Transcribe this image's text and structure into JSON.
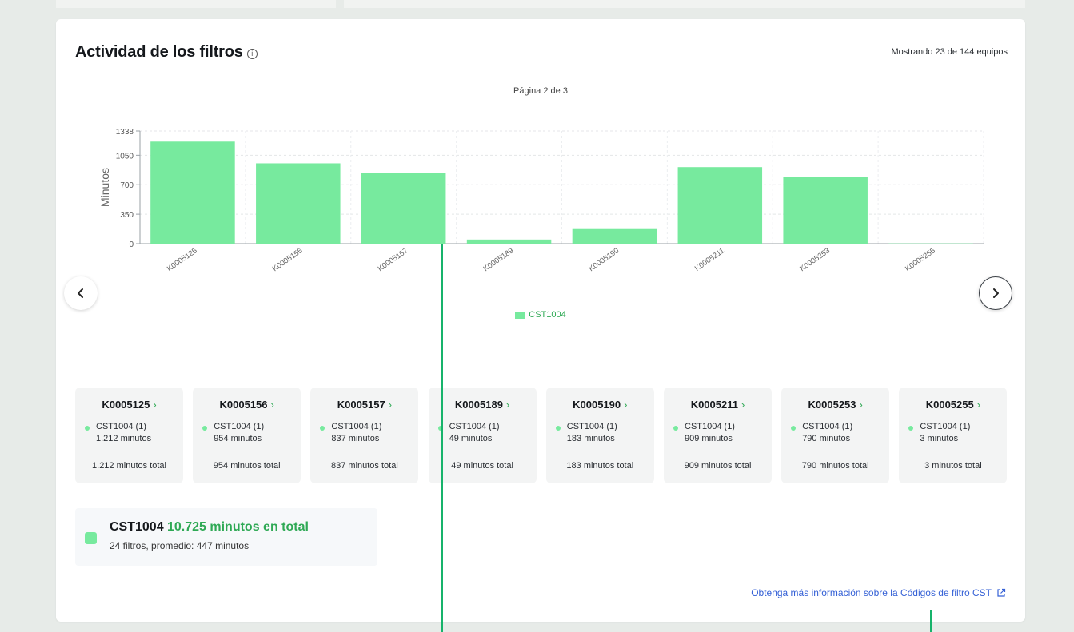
{
  "title": "Actividad de los filtros",
  "showing": "Mostrando 23 de 144 equipos",
  "page_label": "Página 2 de 3",
  "nav": {
    "prev": "‹",
    "next": "›"
  },
  "legend": {
    "label": "CST1004",
    "color": "#77ea9e"
  },
  "chart_data": {
    "type": "bar",
    "categories": [
      "K0005125",
      "K0005156",
      "K0005157",
      "K0005189",
      "K0005190",
      "K0005211",
      "K0005253",
      "K0005255"
    ],
    "series": [
      {
        "name": "CST1004",
        "values": [
          1212,
          954,
          837,
          49,
          183,
          909,
          790,
          3
        ]
      }
    ],
    "ylabel": "Minutos",
    "yticks": [
      0,
      350,
      700,
      1050,
      1338
    ],
    "ylim": [
      0,
      1338
    ],
    "grid": true,
    "color": "#77ea9e"
  },
  "equipment": [
    {
      "id": "K0005125",
      "code": "CST1004 (1)",
      "minutes": "1.212 minutos",
      "total": "1.212 minutos total"
    },
    {
      "id": "K0005156",
      "code": "CST1004 (1)",
      "minutes": "954 minutos",
      "total": "954 minutos total"
    },
    {
      "id": "K0005157",
      "code": "CST1004 (1)",
      "minutes": "837 minutos",
      "total": "837 minutos total"
    },
    {
      "id": "K0005189",
      "code": "CST1004 (1)",
      "minutes": "49 minutos",
      "total": "49 minutos total"
    },
    {
      "id": "K0005190",
      "code": "CST1004 (1)",
      "minutes": "183 minutos",
      "total": "183 minutos total"
    },
    {
      "id": "K0005211",
      "code": "CST1004 (1)",
      "minutes": "909 minutos",
      "total": "909 minutos total"
    },
    {
      "id": "K0005253",
      "code": "CST1004 (1)",
      "minutes": "790 minutos",
      "total": "790 minutos total"
    },
    {
      "id": "K0005255",
      "code": "CST1004 (1)",
      "minutes": "3 minutos",
      "total": "3 minutos total"
    }
  ],
  "summary": {
    "code": "CST1004",
    "total": "10.725 minutos en total",
    "sub": "24 filtros, promedio: 447 minutos"
  },
  "learn_more": "Obtenga más información sobre la Códigos de filtro CST",
  "icons": {
    "info": "info-icon",
    "external": "external-link-icon",
    "chevron": "chevron-right-icon"
  }
}
